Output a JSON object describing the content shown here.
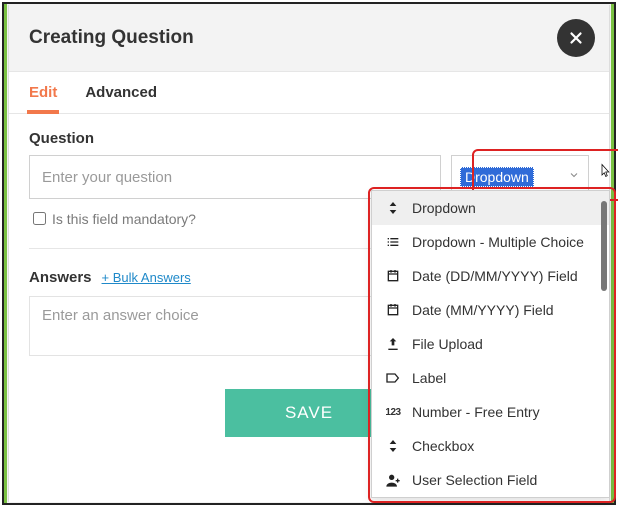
{
  "modal": {
    "title": "Creating Question",
    "close_label": "Close"
  },
  "tabs": {
    "edit": "Edit",
    "advanced": "Advanced"
  },
  "question": {
    "section_label": "Question",
    "placeholder": "Enter your question",
    "type_selected": "Dropdown",
    "mandatory_label": "Is this field mandatory?"
  },
  "answers": {
    "section_label": "Answers",
    "bulk_link": "+ Bulk Answers",
    "placeholder": "Enter an answer choice"
  },
  "actions": {
    "save": "SAVE"
  },
  "dropdown_options": [
    {
      "icon": "sort",
      "label": "Dropdown"
    },
    {
      "icon": "list",
      "label": "Dropdown - Multiple Choice"
    },
    {
      "icon": "calendar",
      "label": "Date (DD/MM/YYYY) Field"
    },
    {
      "icon": "calendar",
      "label": "Date (MM/YYYY) Field"
    },
    {
      "icon": "upload",
      "label": "File Upload"
    },
    {
      "icon": "tag",
      "label": "Label"
    },
    {
      "icon": "number",
      "label": "Number - Free Entry"
    },
    {
      "icon": "sort",
      "label": "Checkbox"
    },
    {
      "icon": "user",
      "label": "User Selection Field"
    }
  ]
}
